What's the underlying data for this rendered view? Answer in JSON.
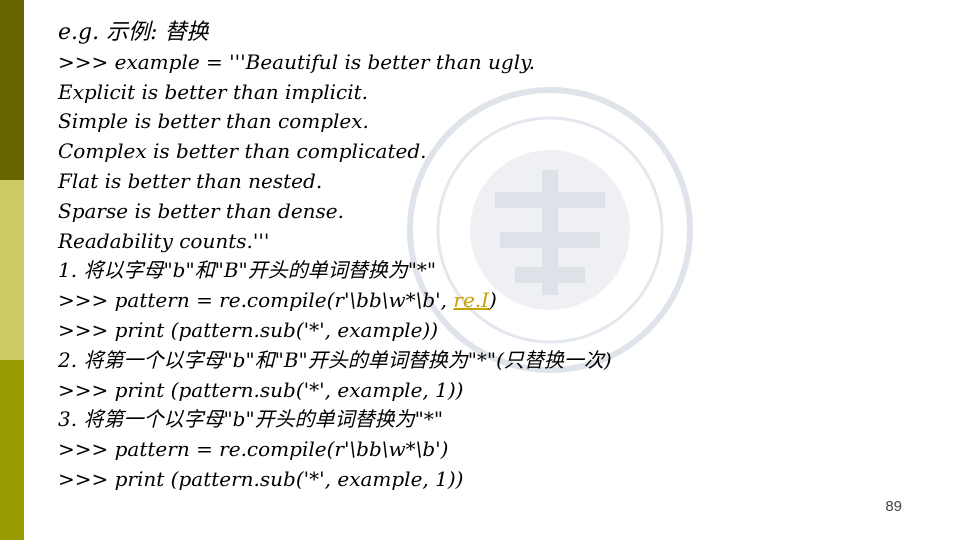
{
  "slide": {
    "page_number": "89",
    "lines": [
      "e.g. 示例: 替换",
      ">>> example = '''Beautiful is better than ugly.",
      "Explicit is better than implicit.",
      "Simple is better than complex.",
      "Complex is better than complicated.",
      "Flat is better than nested.",
      "Sparse is better than dense.",
      "Readability counts.'''",
      "1. 将以字母\"b\"和\"B\"开头的单词替换为\"*\"",
      ">>> pattern = re.compile(r'\\bb\\w*\\b', ",
      ">>> print (pattern.sub('*', example))",
      "2. 将第一个以字母\"b\"和\"B\"开头的单词替换为\"*\"(只替换一次)",
      ">>> print (pattern.sub('*', example, 1))",
      "3. 将第一个以字母\"b\"开头的单词替换为\"*\"",
      ">>> pattern = re.compile(r'\\bb\\w*\\b')",
      ">>> print (pattern.sub('*', example, 1))"
    ],
    "line9_link": "re.I",
    "line9_tail": ")"
  },
  "colors": {
    "sidebar_top": "#666600",
    "sidebar_middle": "#cccc66",
    "sidebar_bottom": "#999900",
    "link": "#c8a000"
  }
}
